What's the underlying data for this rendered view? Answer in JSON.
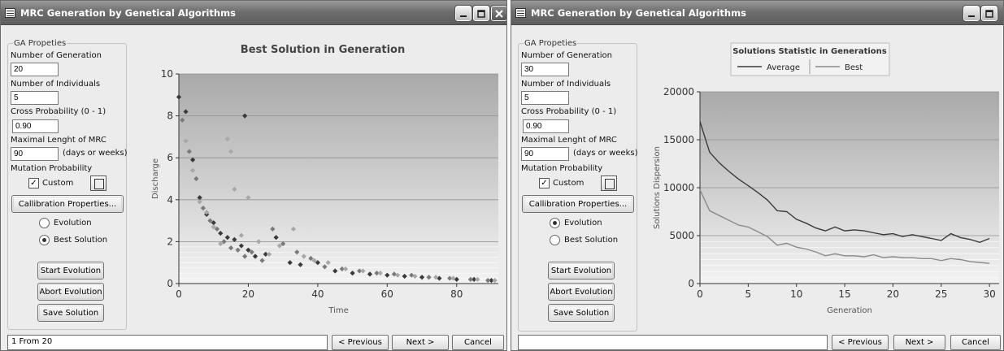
{
  "left": {
    "title": "MRC Generation by Genetical Algorithms",
    "group_title": "GA Propeties",
    "generations_label": "Number of Generation",
    "generations_value": "20",
    "individuals_label": "Number of Individuals",
    "individuals_value": "5",
    "cross_label": "Cross Probability (0 - 1)",
    "cross_value": "0.90",
    "mrc_label": "Maximal Lenght of MRC",
    "mrc_value": "90",
    "mrc_unit": "(days or weeks)",
    "mutation_label": "Mutation Probability",
    "custom_label": "Custom",
    "custom_checked": true,
    "calib_button": "Callibration Properties...",
    "radio_evolution": "Evolution",
    "radio_best": "Best Solution",
    "selected_radio": "best",
    "start_button": "Start Evolution",
    "abort_button": "Abort Evolution",
    "save_button": "Save Solution",
    "status_text": "1 From 20",
    "prev_button": "< Previous",
    "next_button": "Next >",
    "cancel_button": "Cancel"
  },
  "right": {
    "title": "MRC Generation by Genetical Algorithms",
    "group_title": "GA Propeties",
    "generations_label": "Number of Generation",
    "generations_value": "30",
    "individuals_label": "Number of Individuals",
    "individuals_value": "5",
    "cross_label": "Cross Probability (0 - 1)",
    "cross_value": "0.90",
    "mrc_label": "Maximal Lenght of MRC",
    "mrc_value": "90",
    "mrc_unit": "(days or weeks)",
    "mutation_label": "Mutation Probability",
    "custom_label": "Custom",
    "custom_checked": true,
    "calib_button": "Callibration Properties...",
    "radio_evolution": "Evolution",
    "radio_best": "Best Solution",
    "selected_radio": "evolution",
    "start_button": "Start Evolution",
    "abort_button": "Abort Evolution",
    "save_button": "Save Solution",
    "status_text": "",
    "prev_button": "< Previous",
    "next_button": "Next >",
    "cancel_button": "Cancel"
  },
  "chart_data": [
    {
      "type": "scatter",
      "title": "Best Solution in Generation",
      "xlabel": "Time",
      "ylabel": "Discharge",
      "xlim": [
        0,
        92
      ],
      "ylim": [
        0,
        10
      ],
      "xticks": [
        0,
        20,
        40,
        60,
        80
      ],
      "yticks": [
        0,
        2,
        4,
        6,
        8,
        10
      ],
      "grid": true,
      "legend": "none",
      "series": [
        {
          "color": "#3a3a3a",
          "points": [
            [
              0,
              8.9
            ],
            [
              2,
              8.2
            ],
            [
              4,
              5.9
            ],
            [
              6,
              4.1
            ],
            [
              8,
              3.3
            ],
            [
              10,
              2.9
            ],
            [
              12,
              2.4
            ],
            [
              14,
              2.2
            ],
            [
              16,
              2.1
            ],
            [
              18,
              1.8
            ],
            [
              19,
              8.0
            ],
            [
              20,
              1.6
            ],
            [
              22,
              1.3
            ],
            [
              25,
              1.4
            ],
            [
              28,
              2.2
            ],
            [
              32,
              1.0
            ],
            [
              35,
              0.9
            ],
            [
              40,
              1.0
            ],
            [
              45,
              0.6
            ],
            [
              50,
              0.5
            ],
            [
              55,
              0.45
            ],
            [
              60,
              0.4
            ],
            [
              65,
              0.35
            ],
            [
              70,
              0.3
            ],
            [
              75,
              0.25
            ],
            [
              80,
              0.2
            ],
            [
              85,
              0.2
            ],
            [
              90,
              0.15
            ]
          ]
        },
        {
          "color": "#7a7a7a",
          "points": [
            [
              1,
              7.8
            ],
            [
              3,
              6.3
            ],
            [
              5,
              5.0
            ],
            [
              7,
              3.6
            ],
            [
              9,
              3.0
            ],
            [
              11,
              2.6
            ],
            [
              13,
              2.0
            ],
            [
              15,
              1.7
            ],
            [
              17,
              1.6
            ],
            [
              19,
              1.3
            ],
            [
              21,
              1.5
            ],
            [
              24,
              1.1
            ],
            [
              27,
              2.6
            ],
            [
              30,
              1.9
            ],
            [
              34,
              1.5
            ],
            [
              38,
              1.2
            ],
            [
              42,
              0.8
            ],
            [
              47,
              0.7
            ],
            [
              52,
              0.6
            ],
            [
              57,
              0.5
            ],
            [
              62,
              0.45
            ],
            [
              67,
              0.4
            ],
            [
              72,
              0.3
            ],
            [
              78,
              0.25
            ],
            [
              84,
              0.2
            ],
            [
              89,
              0.15
            ]
          ]
        },
        {
          "color": "#a8a8a8",
          "points": [
            [
              2,
              6.8
            ],
            [
              4,
              5.4
            ],
            [
              6,
              3.9
            ],
            [
              8,
              3.4
            ],
            [
              10,
              2.7
            ],
            [
              12,
              1.9
            ],
            [
              14,
              6.9
            ],
            [
              15,
              6.3
            ],
            [
              16,
              4.5
            ],
            [
              18,
              2.3
            ],
            [
              20,
              4.1
            ],
            [
              23,
              2.0
            ],
            [
              26,
              1.4
            ],
            [
              29,
              1.8
            ],
            [
              33,
              2.6
            ],
            [
              36,
              1.3
            ],
            [
              39,
              1.1
            ],
            [
              43,
              1.0
            ],
            [
              48,
              0.7
            ],
            [
              53,
              0.6
            ],
            [
              58,
              0.5
            ],
            [
              63,
              0.4
            ],
            [
              68,
              0.35
            ],
            [
              74,
              0.3
            ],
            [
              79,
              0.25
            ],
            [
              86,
              0.2
            ],
            [
              91,
              0.15
            ]
          ]
        }
      ]
    },
    {
      "type": "line",
      "title": "Solutions Statistic in Generations",
      "xlabel": "Generation",
      "ylabel": "Solutions Dispersion",
      "xlim": [
        0,
        31
      ],
      "ylim": [
        0,
        20000
      ],
      "xticks": [
        0,
        5,
        10,
        15,
        20,
        25,
        30
      ],
      "yticks": [
        0,
        5000,
        10000,
        15000,
        20000
      ],
      "grid": true,
      "legend": "top",
      "x": [
        0,
        1,
        2,
        3,
        4,
        5,
        6,
        7,
        8,
        9,
        10,
        11,
        12,
        13,
        14,
        15,
        16,
        17,
        18,
        19,
        20,
        21,
        22,
        23,
        24,
        25,
        26,
        27,
        28,
        29,
        30
      ],
      "series": [
        {
          "name": "Average",
          "color": "#3a3a3a",
          "values": [
            16900,
            13700,
            12600,
            11700,
            10900,
            10200,
            9500,
            8700,
            7600,
            7500,
            6700,
            6300,
            5800,
            5500,
            5900,
            5500,
            5600,
            5500,
            5300,
            5100,
            5200,
            4900,
            5100,
            4900,
            4700,
            4500,
            5200,
            4800,
            4600,
            4300,
            4700
          ]
        },
        {
          "name": "Best",
          "color": "#8a8a8a",
          "values": [
            9800,
            7600,
            7100,
            6600,
            6100,
            5900,
            5400,
            4900,
            4000,
            4200,
            3800,
            3600,
            3300,
            2900,
            3100,
            2900,
            2900,
            2800,
            3000,
            2700,
            2800,
            2700,
            2700,
            2600,
            2600,
            2400,
            2600,
            2500,
            2300,
            2200,
            2100
          ]
        }
      ]
    }
  ]
}
